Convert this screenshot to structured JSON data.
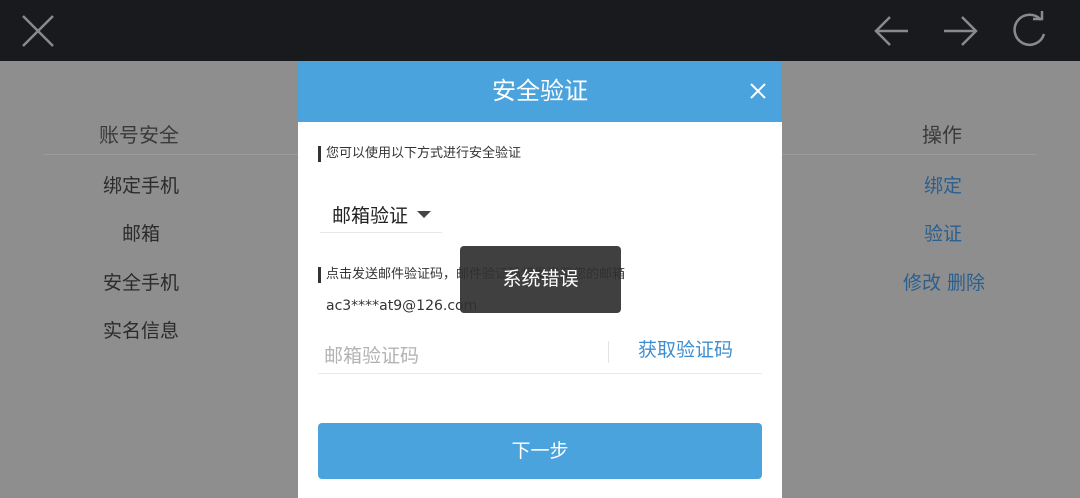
{
  "browser": {
    "icons": {
      "close": "close-icon",
      "back": "arrow-left-icon",
      "forward": "arrow-right-icon",
      "reload": "reload-icon"
    }
  },
  "page": {
    "headers": {
      "left": "账号安全",
      "right": "操作"
    },
    "rows": [
      {
        "name": "绑定手机",
        "action": "绑定"
      },
      {
        "name": "邮箱",
        "action": "验证"
      },
      {
        "name": "安全手机",
        "action": "修改 删除"
      },
      {
        "name": "实名信息",
        "action": ""
      }
    ]
  },
  "modal": {
    "title": "安全验证",
    "hint1": "您可以使用以下方式进行安全验证",
    "method_label": "邮箱验证",
    "hint2": "点击发送邮件验证码，邮件验证码将发送至您的邮箱",
    "email": "ac3****at9@126.com",
    "code_placeholder": "邮箱验证码",
    "get_code_label": "获取验证码",
    "next_label": "下一步"
  },
  "toast": {
    "message": "系统错误"
  },
  "colors": {
    "accent": "#4BA3DE",
    "link": "#3D8FD1",
    "topbar": "#181A1E"
  }
}
